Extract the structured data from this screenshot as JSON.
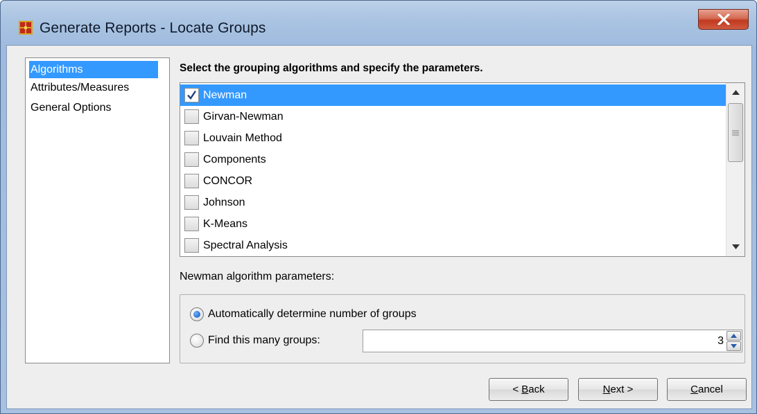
{
  "window": {
    "title": "Generate Reports - Locate Groups",
    "close_label": "X"
  },
  "nav": {
    "items": [
      {
        "label": "Algorithms",
        "selected": true
      },
      {
        "label": "Attributes/Measures",
        "selected": false
      },
      {
        "label": "General Options",
        "selected": false
      }
    ]
  },
  "main": {
    "heading": "Select the grouping algorithms and specify the parameters.",
    "algorithms": [
      {
        "label": "Newman",
        "checked": true,
        "selected": true
      },
      {
        "label": "Girvan-Newman",
        "checked": false,
        "selected": false
      },
      {
        "label": "Louvain Method",
        "checked": false,
        "selected": false
      },
      {
        "label": "Components",
        "checked": false,
        "selected": false
      },
      {
        "label": "CONCOR",
        "checked": false,
        "selected": false
      },
      {
        "label": "Johnson",
        "checked": false,
        "selected": false
      },
      {
        "label": "K-Means",
        "checked": false,
        "selected": false
      },
      {
        "label": "Spectral Analysis",
        "checked": false,
        "selected": false
      }
    ],
    "params_label": "Newman algorithm parameters:",
    "params": {
      "auto_label": "Automatically determine number of groups",
      "auto_selected": true,
      "find_label": "Find this many groups:",
      "find_selected": false,
      "group_count": "3"
    }
  },
  "buttons": {
    "back_prefix": "< ",
    "back_mnemonic": "B",
    "back_rest": "ack",
    "next_mnemonic": "N",
    "next_rest": "ext >",
    "cancel_mnemonic": "C",
    "cancel_rest": "ancel"
  },
  "colors": {
    "selection": "#3399ff",
    "close_button": "#c7432b"
  }
}
